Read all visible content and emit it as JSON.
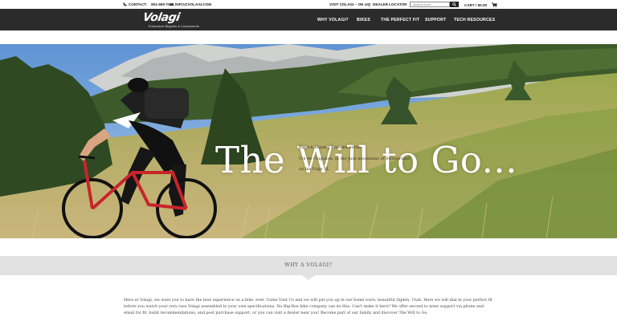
{
  "topbar": {
    "contact_label": "CONTACT:",
    "phone": "801-690-7001",
    "email": "INFO@VOLAGI.COM",
    "visit_link": "VISIT VOLAGI – ON US!",
    "dealer_locator": "DEALER LOCATOR",
    "search_placeholder": "search here",
    "cart_label": "CART / $0.00"
  },
  "nav": {
    "logo_text": "Volagi",
    "logo_tagline": "Endurance Bicycles & Components",
    "items": [
      "WHY VOLAGI?",
      "BIKES",
      "THE PERFECT FIT",
      "SUPPORT",
      "TECH RESOURCES"
    ]
  },
  "hero": {
    "title": "The Will to Go...",
    "caption_lines": [
      "Patrick Stanley Reinolla at the",
      "Col de l'Aigullon, in the Jura mountains of Switzerland",
      "on his Viaje XL"
    ]
  },
  "why_section": {
    "label": "WHY A VOLAGI?",
    "intro": "Here at Volagi, we want you to have the best experience on a bike, ever. Come Visit Us and we will put you up in our home town, beautiful Ogden, Utah. Here we will dial in your perfect fit before you watch your very own Volagi assembled to your own specifications. No Big-Box bike company can do this. Can't make it here? We offer second to none support via phone and email for fit, build recommendations, and post purchase support, or you can visit a dealer near you! Become part of our family and discover The Will to Go."
  },
  "colors": {
    "nav_bg": "#2b2b2b",
    "why_bar_bg": "#e2e2e2",
    "hero_text": "#ffffff"
  }
}
